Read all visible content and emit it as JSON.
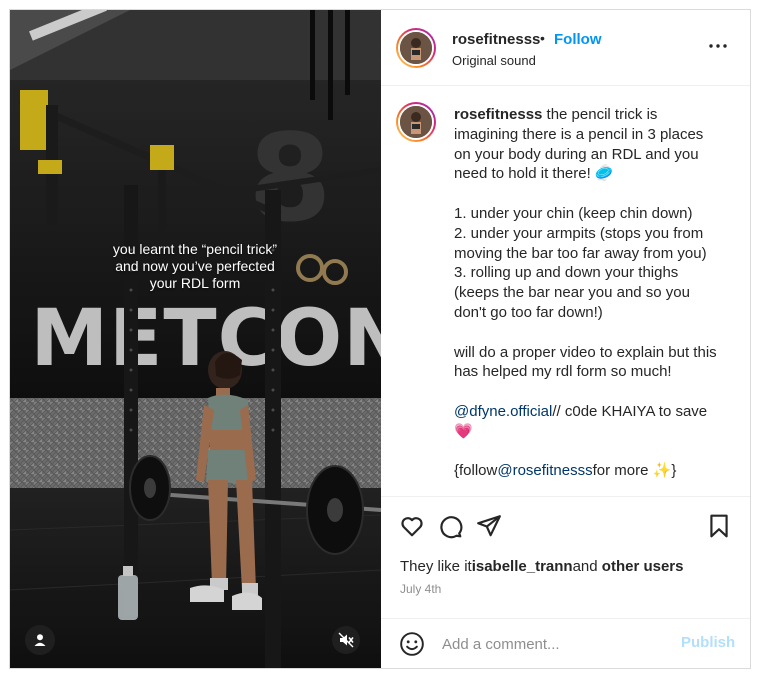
{
  "media": {
    "overlay_caption": [
      "you learnt the “pencil trick”",
      "and now you’ve perfected",
      "your RDL form"
    ],
    "wall_text": "METCON",
    "tag_icon": "user-tag-icon",
    "mute_icon": "muted-speaker-icon"
  },
  "header": {
    "username": "rosefitnesss",
    "separator": "•",
    "follow_label": "Follow",
    "audio": "Original sound",
    "more_icon": "more-options-icon"
  },
  "caption": {
    "username": "rosefitnesss",
    "text_part1": " the pencil trick is imagining there is a pencil in 3 places on your body during an RDL and you need to hold it there! 🥏\n\n1. under your chin (keep chin down)\n2. under your armpits (stops you from moving the bar too far away from you)\n3. rolling up and down your thighs (keeps the bar near you and so you don't go too far down!)\n\nwill do a proper video to explain but this has helped my rdl form so much!\n\n",
    "mention1": "@dfyne.official",
    "text_part2": "// c0de KHAIYA to save 💗\n\n{follow",
    "mention2": "@rosefitnesss",
    "text_part3": "for more ✨}"
  },
  "actions": {
    "like_icon": "heart-icon",
    "comment_icon": "comment-icon",
    "share_icon": "share-icon",
    "save_icon": "bookmark-icon",
    "likes_prefix": "They like it",
    "likes_user": "isabelle_trann",
    "likes_mid": "and ",
    "likes_others": "other users",
    "date": "July 4th"
  },
  "comment_box": {
    "emoji_icon": "emoji-icon",
    "placeholder": "Add a comment...",
    "publish_label": "Publish"
  },
  "colors": {
    "follow_blue": "#0095f6",
    "publish_disabled": "#b2dffc",
    "mention": "#00376b",
    "secondary_text": "#8e8e8e"
  }
}
